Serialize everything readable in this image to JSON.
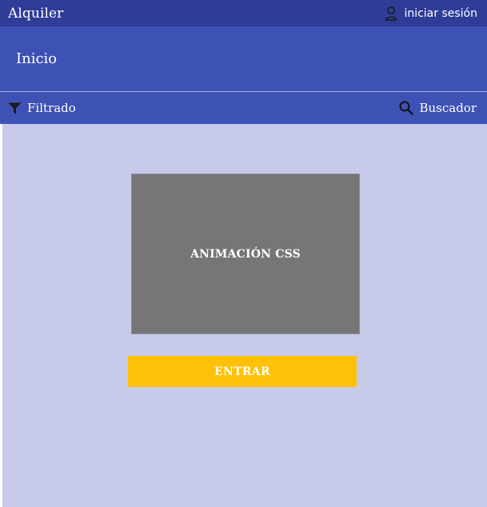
{
  "topbar": {
    "brand": "Alquiler",
    "login_label": "iniciar sesión",
    "login_icon": "user-icon",
    "background": "#2f3c98"
  },
  "header": {
    "title": "Inicio",
    "background": "#3e51b5"
  },
  "toolbar": {
    "filter_label": "Filtrado",
    "filter_icon": "filter-icon",
    "search_label": "Buscador",
    "search_icon": "search-icon"
  },
  "main": {
    "background": "#c7cae9",
    "animation_label": "ANIMACIÓN CSS",
    "enter_label": "ENTRAR",
    "enter_color": "#ffc107"
  }
}
